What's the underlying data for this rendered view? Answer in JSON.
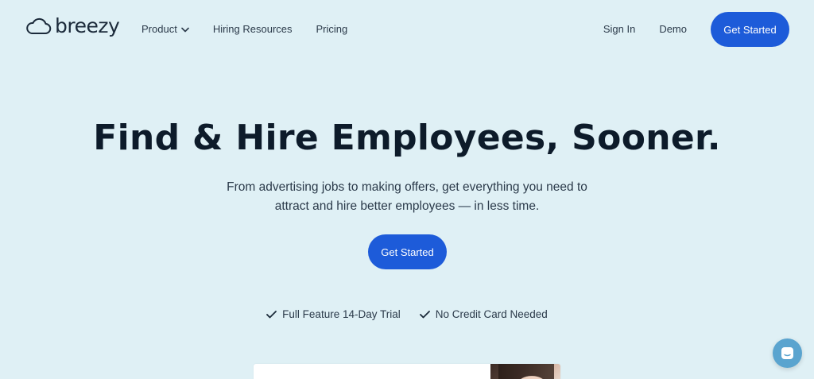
{
  "brand": {
    "name": "breezy",
    "logo_icon": "cloud-icon"
  },
  "nav": {
    "product": "Product",
    "hiring_resources": "Hiring Resources",
    "pricing": "Pricing",
    "sign_in": "Sign In",
    "demo": "Demo",
    "get_started": "Get Started"
  },
  "hero": {
    "title": "Find & Hire Employees, Sooner.",
    "subtitle": "From advertising jobs to making offers, get everything you need to attract and hire better employees — in less time.",
    "cta": "Get Started"
  },
  "features": [
    {
      "icon": "check-icon",
      "label": "Full Feature 14-Day Trial"
    },
    {
      "icon": "check-icon",
      "label": "No Credit Card Needed"
    }
  ],
  "chat": {
    "icon": "chat-icon"
  },
  "colors": {
    "background": "#dff0f5",
    "accent": "#1d5bd9",
    "text": "#0d1b2a",
    "chat": "#5aa4cf"
  }
}
